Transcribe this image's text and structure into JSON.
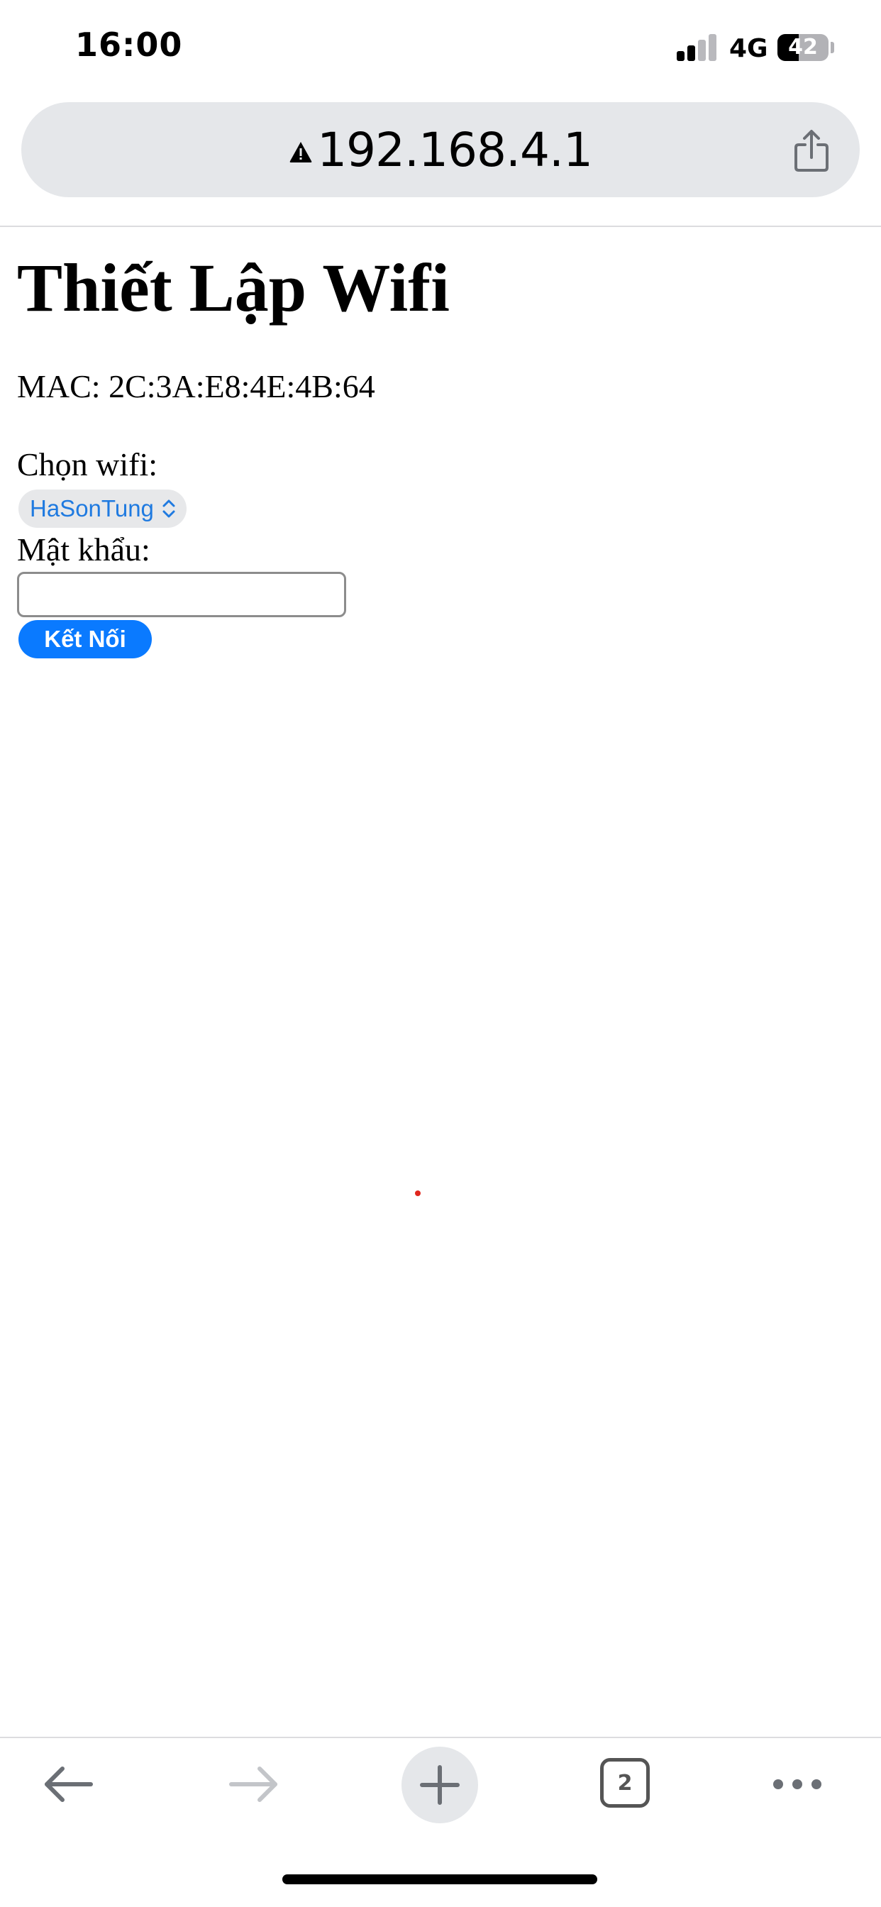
{
  "status_bar": {
    "time": "16:00",
    "network": "4G",
    "battery_level": "42",
    "battery_fraction": 0.42,
    "signal_bars_active": 2,
    "signal_bars_total": 4
  },
  "address_bar": {
    "url": "192.168.4.1",
    "warning_icon": "warning-triangle-icon",
    "share_icon": "share-icon"
  },
  "page": {
    "title": "Thiết Lập Wifi",
    "mac_line": "MAC: 2C:3A:E8:4E:4B:64",
    "choose_wifi_label": "Chọn wifi:",
    "selected_wifi": "HaSonTung",
    "password_label": "Mật khẩu:",
    "password_value": "",
    "connect_button": "Kết Nối"
  },
  "toolbar": {
    "back_icon": "arrow-left-icon",
    "forward_icon": "arrow-right-icon",
    "new_tab_icon": "plus-icon",
    "tab_count": "2",
    "more_icon": "more-icon"
  },
  "colors": {
    "accent": "#0a7aff",
    "select_text": "#1f7ae0",
    "address_bar_bg": "#e5e7ea",
    "marker_dot": "#e0261d"
  }
}
